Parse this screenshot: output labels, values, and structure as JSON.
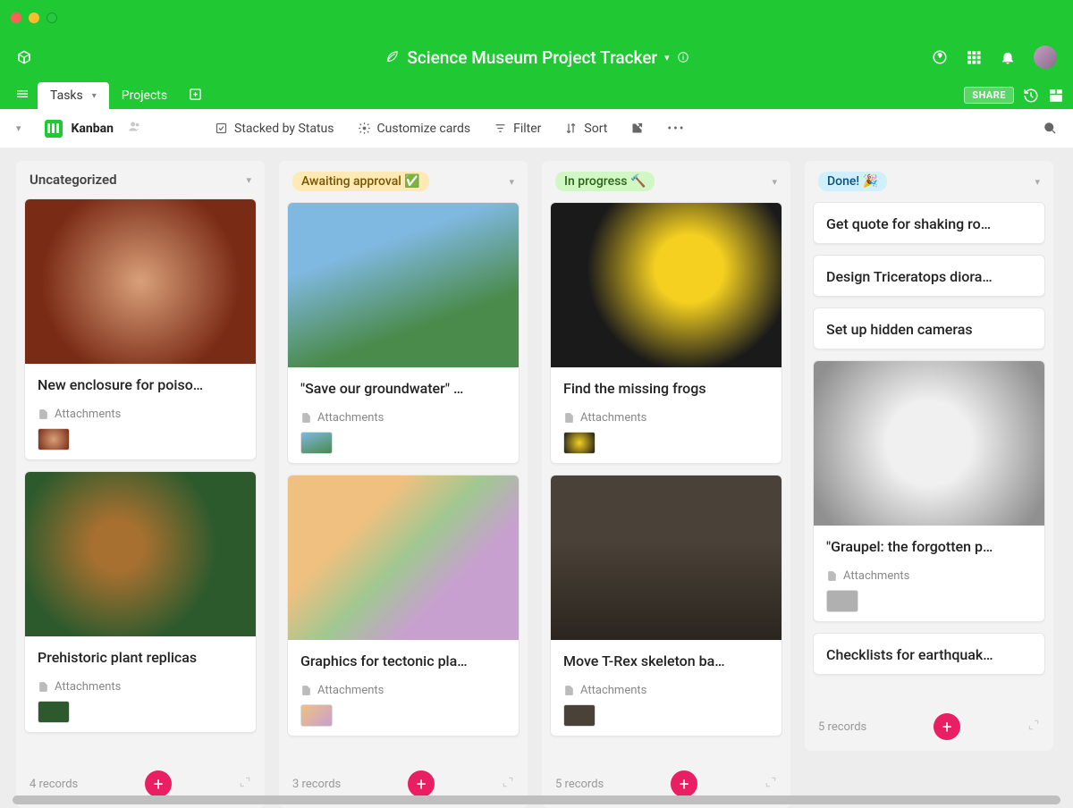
{
  "window": {
    "title": "Science Museum Project Tracker"
  },
  "tabs": {
    "tasks": "Tasks",
    "projects": "Projects"
  },
  "toolbar": {
    "view": "Kanban",
    "stacked": "Stacked by Status",
    "customize": "Customize cards",
    "filter": "Filter",
    "sort": "Sort",
    "share": "SHARE"
  },
  "columns": {
    "uncat": {
      "title": "Uncategorized",
      "footer": "4 records",
      "cards": [
        {
          "title": "New enclosure for poiso…",
          "attach": "Attachments"
        },
        {
          "title": "Prehistoric plant replicas",
          "attach": "Attachments"
        }
      ]
    },
    "await": {
      "title": "Awaiting approval ✅",
      "footer": "3 records",
      "cards": [
        {
          "title": "\"Save our groundwater\" …",
          "attach": "Attachments"
        },
        {
          "title": "Graphics for tectonic pla…",
          "attach": "Attachments"
        }
      ]
    },
    "prog": {
      "title": "In progress 🔨",
      "footer": "5 records",
      "cards": [
        {
          "title": "Find the missing frogs",
          "attach": "Attachments"
        },
        {
          "title": "Move T-Rex skeleton ba…",
          "attach": "Attachments"
        }
      ]
    },
    "done": {
      "title": "Done! 🎉",
      "footer": "5 records",
      "cards": [
        {
          "title": "Get quote for shaking ro…"
        },
        {
          "title": "Design Triceratops diora…"
        },
        {
          "title": "Set up hidden cameras"
        },
        {
          "title": "\"Graupel: the forgotten p…",
          "attach": "Attachments"
        },
        {
          "title": "Checklists for earthquak…"
        }
      ]
    }
  }
}
